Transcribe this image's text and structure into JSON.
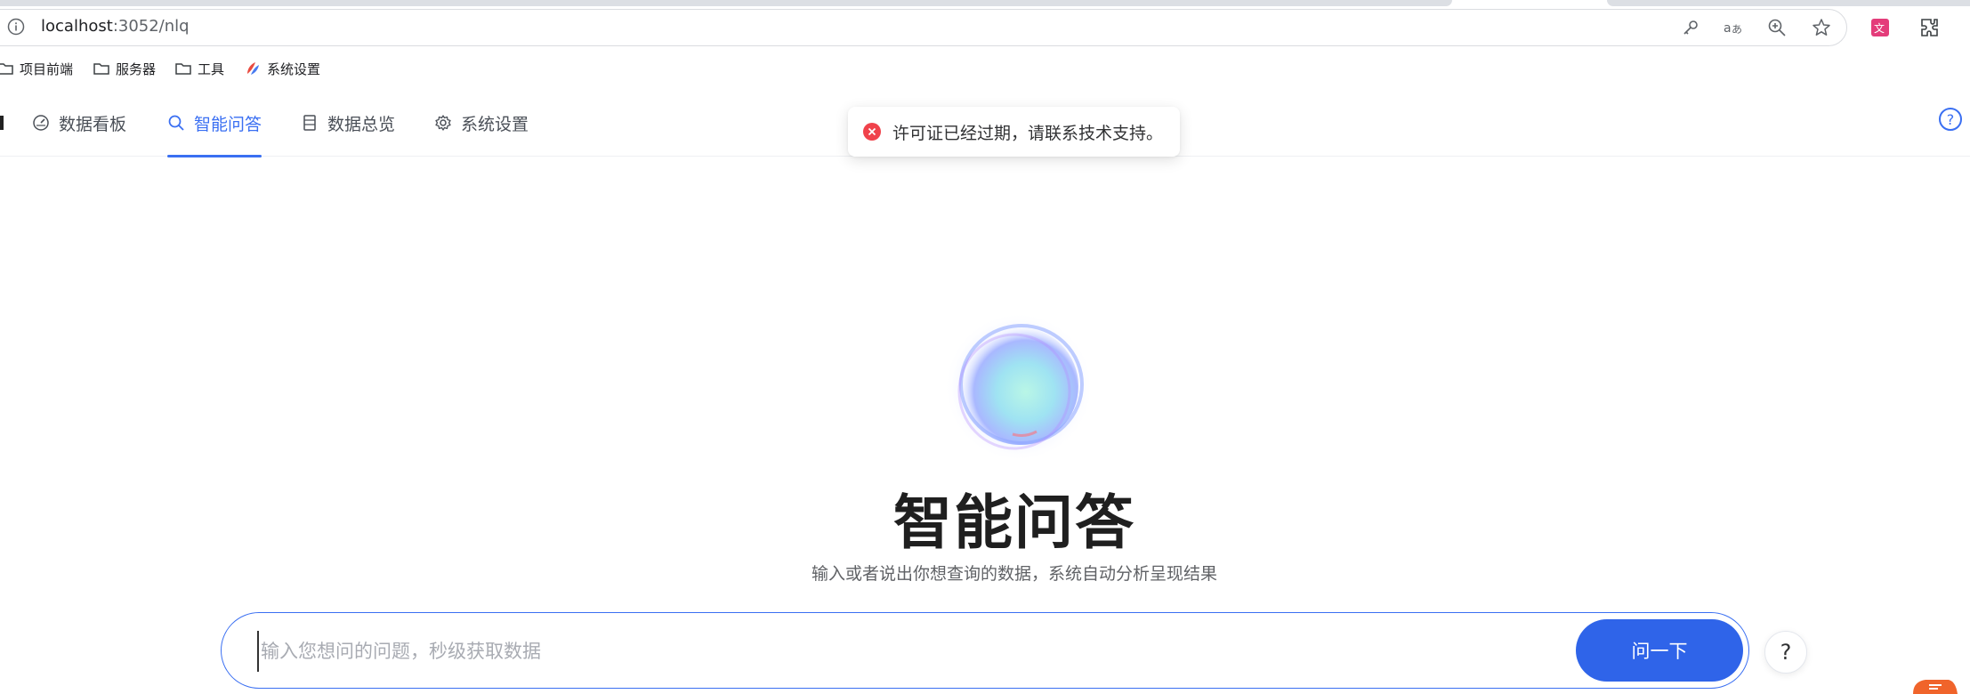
{
  "browser": {
    "url_host": "localhost",
    "url_rest": ":3052/nlq"
  },
  "bookmarks": [
    {
      "label": "项目前端",
      "icon": "folder-icon"
    },
    {
      "label": "服务器",
      "icon": "folder-icon"
    },
    {
      "label": "工具",
      "icon": "folder-icon"
    },
    {
      "label": "系统设置",
      "icon": "app-logo-icon"
    }
  ],
  "nav": {
    "items": [
      {
        "label": "数据看板",
        "icon": "dashboard-icon",
        "active": false
      },
      {
        "label": "智能问答",
        "icon": "search-icon",
        "active": true
      },
      {
        "label": "数据总览",
        "icon": "document-icon",
        "active": false
      },
      {
        "label": "系统设置",
        "icon": "gear-icon",
        "active": false
      }
    ]
  },
  "toast": {
    "message": "许可证已经过期，请联系技术支持。",
    "type": "error"
  },
  "hero": {
    "title": "智能问答",
    "subtitle": "输入或者说出你想查询的数据，系统自动分析呈现结果"
  },
  "ask": {
    "placeholder": "输入您想问的问题，秒级获取数据",
    "value": "",
    "button_label": "问一下",
    "help_label": "?"
  },
  "colors": {
    "accent": "#3a6ff2",
    "button": "#2f64e9",
    "error": "#f0424b"
  }
}
